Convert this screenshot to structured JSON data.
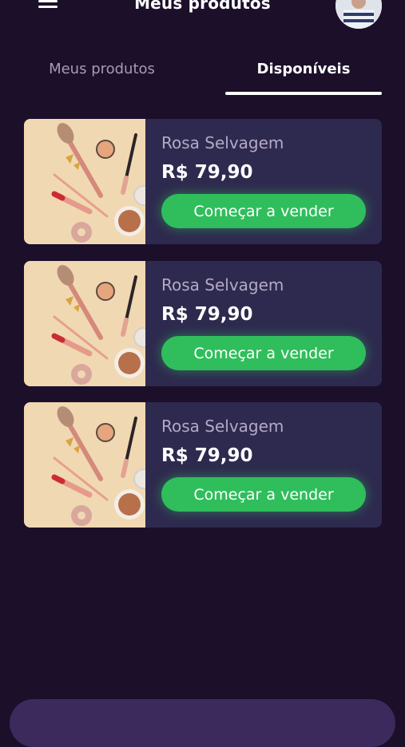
{
  "header": {
    "title": "Meus produtos",
    "menu_icon": "hamburger-menu-icon",
    "avatar_icon": "user-avatar"
  },
  "tabs": [
    {
      "label": "Meus produtos",
      "active": false
    },
    {
      "label": "Disponíveis",
      "active": true
    }
  ],
  "products": [
    {
      "name": "Rosa Selvagem",
      "price": "R$ 79,90",
      "button": "Começar a vender",
      "image_icon": "makeup-products-image"
    },
    {
      "name": "Rosa Selvagem",
      "price": "R$ 79,90",
      "button": "Começar a vender",
      "image_icon": "makeup-products-image"
    },
    {
      "name": "Rosa Selvagem",
      "price": "R$ 79,90",
      "button": "Começar a vender",
      "image_icon": "makeup-products-image"
    }
  ],
  "colors": {
    "background": "#1b0f2a",
    "card": "#2e2a4f",
    "accent_green": "#2fbe5b",
    "muted_text": "#b3a9c7"
  }
}
